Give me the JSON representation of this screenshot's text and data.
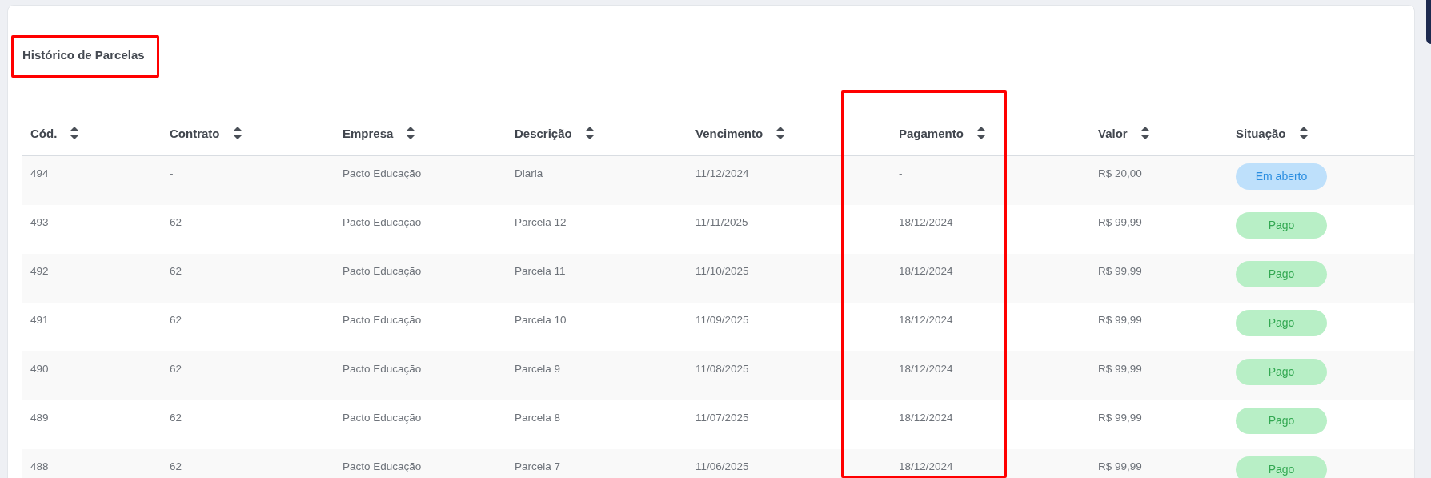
{
  "title": "Histórico de Parcelas",
  "table": {
    "columns": [
      "Cód.",
      "Contrato",
      "Empresa",
      "Descrição",
      "Vencimento",
      "Pagamento",
      "Valor",
      "Situação"
    ],
    "rows": [
      {
        "cells": [
          "494",
          "-",
          "Pacto Educação",
          "Diaria",
          "11/12/2024",
          "-",
          "R$ 20,00"
        ],
        "status": {
          "label": "Em aberto",
          "kind": "open"
        }
      },
      {
        "cells": [
          "493",
          "62",
          "Pacto Educação",
          "Parcela 12",
          "11/11/2025",
          "18/12/2024",
          "R$ 99,99"
        ],
        "status": {
          "label": "Pago",
          "kind": "paid"
        }
      },
      {
        "cells": [
          "492",
          "62",
          "Pacto Educação",
          "Parcela 11",
          "11/10/2025",
          "18/12/2024",
          "R$ 99,99"
        ],
        "status": {
          "label": "Pago",
          "kind": "paid"
        }
      },
      {
        "cells": [
          "491",
          "62",
          "Pacto Educação",
          "Parcela 10",
          "11/09/2025",
          "18/12/2024",
          "R$ 99,99"
        ],
        "status": {
          "label": "Pago",
          "kind": "paid"
        }
      },
      {
        "cells": [
          "490",
          "62",
          "Pacto Educação",
          "Parcela 9",
          "11/08/2025",
          "18/12/2024",
          "R$ 99,99"
        ],
        "status": {
          "label": "Pago",
          "kind": "paid"
        }
      },
      {
        "cells": [
          "489",
          "62",
          "Pacto Educação",
          "Parcela 8",
          "11/07/2025",
          "18/12/2024",
          "R$ 99,99"
        ],
        "status": {
          "label": "Pago",
          "kind": "paid"
        }
      },
      {
        "cells": [
          "488",
          "62",
          "Pacto Educação",
          "Parcela 7",
          "11/06/2025",
          "18/12/2024",
          "R$ 99,99"
        ],
        "status": {
          "label": "Pago",
          "kind": "paid"
        }
      }
    ]
  }
}
